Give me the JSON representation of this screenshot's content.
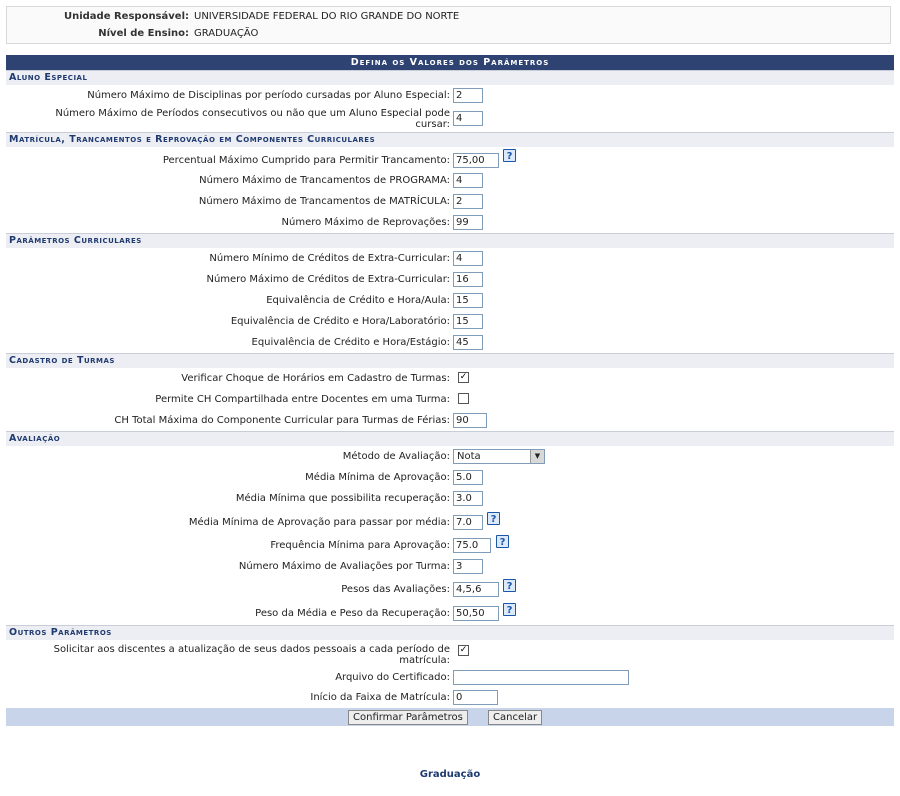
{
  "header": {
    "unidade_label": "Unidade Responsável:",
    "unidade_value": "UNIVERSIDADE FEDERAL DO RIO GRANDE DO NORTE",
    "nivel_label": "Nível de Ensino:",
    "nivel_value": "GRADUAÇÃO"
  },
  "form": {
    "caption": "Defina os Valores dos Parâmetros",
    "aluno_especial": {
      "title": "Aluno Especial",
      "max_disciplinas_label": "Número Máximo de Disciplinas por período cursadas por Aluno Especial:",
      "max_disciplinas_value": "2",
      "max_periodos_label_1": "Número Máximo de Períodos consecutivos ou não que um Aluno Especial pode",
      "max_periodos_label_2": "cursar:",
      "max_periodos_value": "4"
    },
    "matricula": {
      "title": "Matrícula, Trancamentos e Reprovação em Componentes Curriculares",
      "percentual_label": "Percentual Máximo Cumprido para Permitir Trancamento:",
      "percentual_value": "75,00",
      "tranc_programa_label": "Número Máximo de Trancamentos de PROGRAMA:",
      "tranc_programa_value": "4",
      "tranc_matricula_label": "Número Máximo de Trancamentos de MATRÍCULA:",
      "tranc_matricula_value": "2",
      "reprovacoes_label": "Número Máximo de Reprovações:",
      "reprovacoes_value": "99"
    },
    "curriculares": {
      "title": "Parâmetros Curriculares",
      "min_creditos_label": "Número Mínimo de Créditos de Extra-Curricular:",
      "min_creditos_value": "4",
      "max_creditos_label": "Número Máximo de Créditos de Extra-Curricular:",
      "max_creditos_value": "16",
      "equiv_aula_label": "Equivalência de Crédito e Hora/Aula:",
      "equiv_aula_value": "15",
      "equiv_lab_label": "Equivalência de Crédito e Hora/Laboratório:",
      "equiv_lab_value": "15",
      "equiv_estagio_label": "Equivalência de Crédito e Hora/Estágio:",
      "equiv_estagio_value": "45"
    },
    "turmas": {
      "title": "Cadastro de Turmas",
      "choque_label": "Verificar Choque de Horários em Cadastro de Turmas:",
      "choque_checked": true,
      "ch_compartilhada_label": "Permite CH Compartilhada entre Docentes em uma Turma:",
      "ch_compartilhada_checked": false,
      "ch_ferias_label": "CH Total Máxima do Componente Curricular para Turmas de Férias:",
      "ch_ferias_value": "90"
    },
    "avaliacao": {
      "title": "Avaliação",
      "metodo_label": "Método de Avaliação:",
      "metodo_value": "Nota",
      "media_aprov_label": "Média Mínima de Aprovação:",
      "media_aprov_value": "5.0",
      "media_rec_label": "Média Mínima que possibilita recuperação:",
      "media_rec_value": "3.0",
      "media_passar_label": "Média Mínima de Aprovação para passar por média:",
      "media_passar_value": "7.0",
      "frequencia_label": "Frequência Mínima para Aprovação:",
      "frequencia_value": "75.0",
      "num_aval_label": "Número Máximo de Avaliações por Turma:",
      "num_aval_value": "3",
      "pesos_label": "Pesos das Avaliações:",
      "pesos_value": "4,5,6",
      "peso_media_label": "Peso da Média e Peso da Recuperação:",
      "peso_media_value": "50,50"
    },
    "outros": {
      "title": "Outros Parâmetros",
      "atualizacao_label_1": "Solicitar aos discentes a atualização de seus dados pessoais a cada período de",
      "atualizacao_label_2": "matrícula:",
      "atualizacao_checked": true,
      "certificado_label": "Arquivo do Certificado:",
      "certificado_value": "",
      "faixa_label": "Início da Faixa de Matrícula:",
      "faixa_value": "0"
    },
    "buttons": {
      "confirm": "Confirmar Parâmetros",
      "cancel": "Cancelar"
    }
  },
  "icons": {
    "help": "?",
    "check": "✓",
    "dropdown": "▼"
  },
  "footer_link": "Graduação"
}
